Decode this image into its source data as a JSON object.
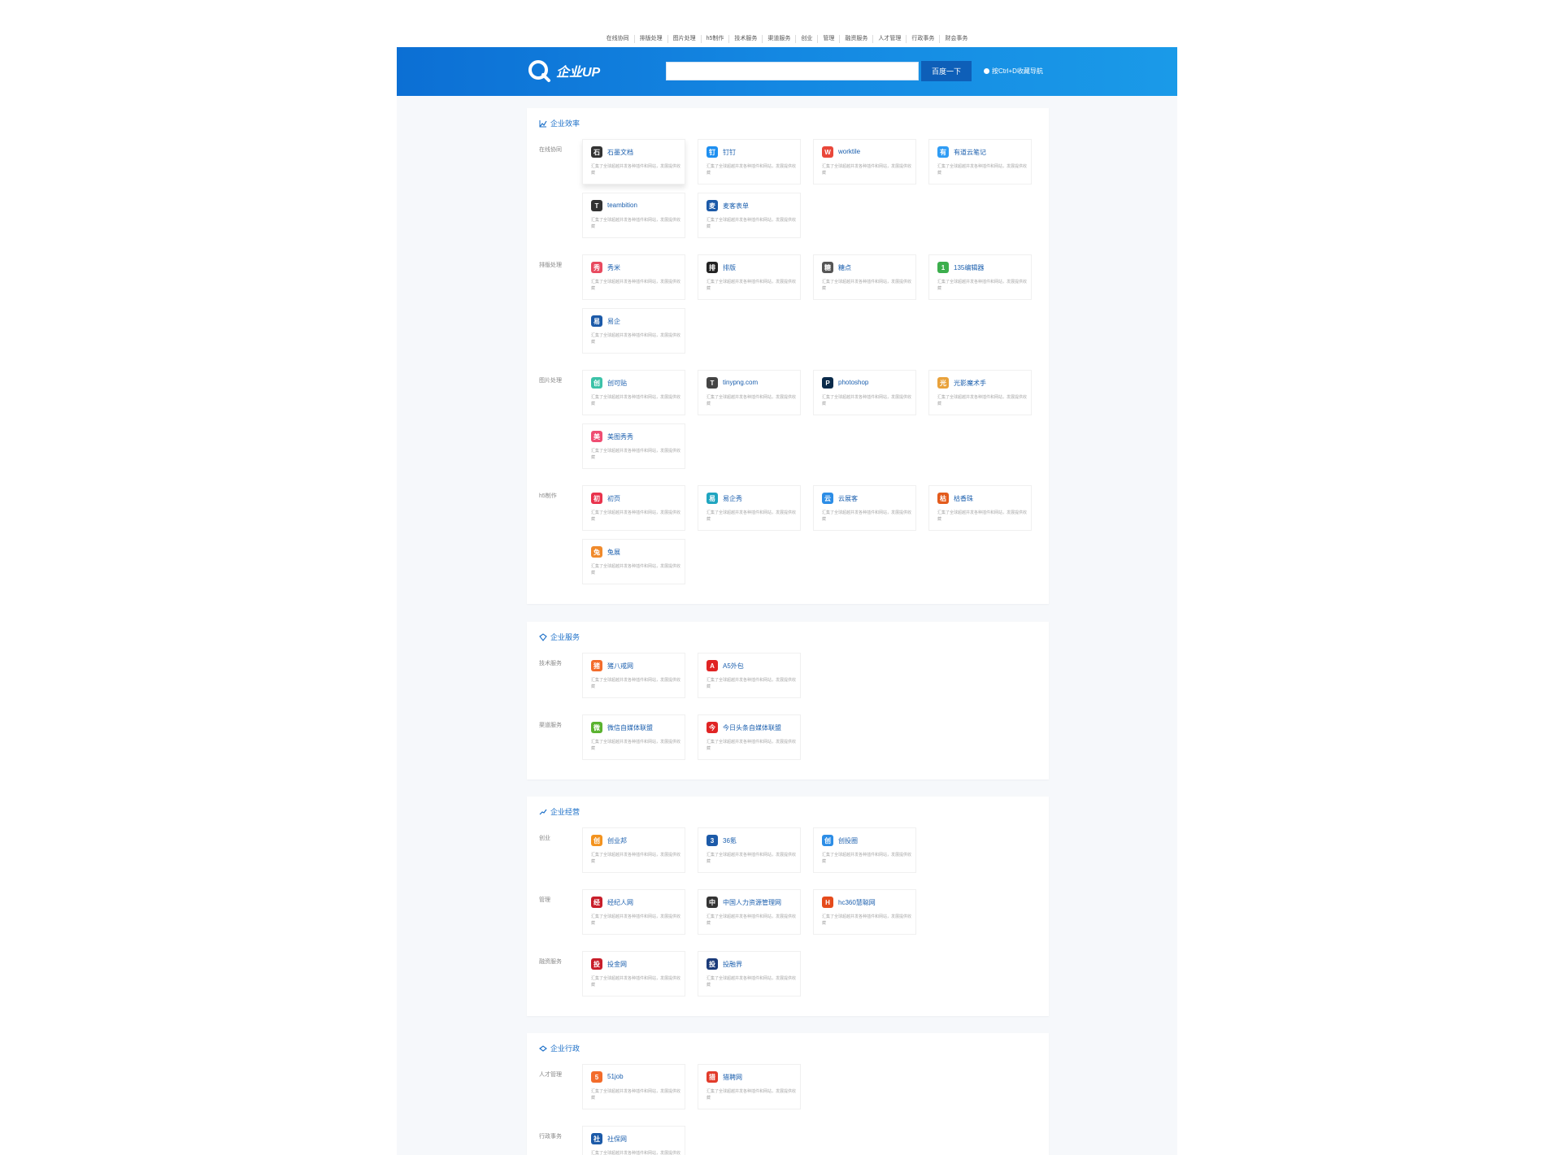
{
  "topnav": [
    "在线协同",
    "排版处理",
    "图片处理",
    "h5制作",
    "技术服务",
    "渠道服务",
    "创业",
    "管理",
    "融资服务",
    "人才管理",
    "行政事务",
    "财会事务"
  ],
  "header": {
    "logo_text": "企业UP",
    "search_placeholder": "",
    "search_button": "百度一下",
    "favorite_hint": "按Ctrl+D收藏导航"
  },
  "card_desc": "汇集了全球超越并发各种插件和网站，发展提供收藏",
  "sections": [
    {
      "title": "企业效率",
      "groups": [
        {
          "label": "在线协同",
          "items": [
            {
              "name": "石墨文档",
              "icon": "shimo-icon",
              "color": "#333333"
            },
            {
              "name": "钉钉",
              "icon": "dingtalk-icon",
              "color": "#1e8ff0"
            },
            {
              "name": "worktile",
              "icon": "worktile-icon",
              "color": "#e9473a"
            },
            {
              "name": "有道云笔记",
              "icon": "youdao-note-icon",
              "color": "#2f9cf4"
            },
            {
              "name": "teambition",
              "icon": "teambition-icon",
              "color": "#333333"
            },
            {
              "name": "麦客表单",
              "icon": "mikecrm-icon",
              "color": "#1c5aa8"
            }
          ]
        },
        {
          "label": "排版处理",
          "items": [
            {
              "name": "秀米",
              "icon": "xiumi-icon",
              "color": "#e84a5f"
            },
            {
              "name": "排版",
              "icon": "paiban-icon",
              "color": "#222222"
            },
            {
              "name": "糖点",
              "icon": "tangdian-icon",
              "color": "#555555"
            },
            {
              "name": "135编辑器",
              "icon": "135-editor-icon",
              "color": "#3cae4d"
            },
            {
              "name": "易企",
              "icon": "yiqi-icon",
              "color": "#1c5aa8"
            }
          ]
        },
        {
          "label": "图片处理",
          "items": [
            {
              "name": "创可贴",
              "icon": "chuangkit-icon",
              "color": "#3cc2a8"
            },
            {
              "name": "tinypng.com",
              "icon": "tinypng-icon",
              "color": "#444444"
            },
            {
              "name": "photoshop",
              "icon": "photoshop-icon",
              "color": "#0a2a4a"
            },
            {
              "name": "光影魔术手",
              "icon": "neoimaging-icon",
              "color": "#e9a23b"
            },
            {
              "name": "美图秀秀",
              "icon": "meitu-icon",
              "color": "#ef4d72"
            }
          ]
        },
        {
          "label": "h5制作",
          "items": [
            {
              "name": "初页",
              "icon": "chuye-icon",
              "color": "#e9334d"
            },
            {
              "name": "易企秀",
              "icon": "eqxiu-icon",
              "color": "#1fa5c0"
            },
            {
              "name": "云展客",
              "icon": "yunzhanke-icon",
              "color": "#2c8de6"
            },
            {
              "name": "枯香珠",
              "icon": "kuxiang-icon",
              "color": "#e35b1c"
            },
            {
              "name": "兔展",
              "icon": "rabbitpre-icon",
              "color": "#f08a2c"
            }
          ]
        }
      ]
    },
    {
      "title": "企业服务",
      "groups": [
        {
          "label": "技术服务",
          "items": [
            {
              "name": "猪八戒网",
              "icon": "zbj-icon",
              "color": "#f36c2b"
            },
            {
              "name": "A5外包",
              "icon": "a5-icon",
              "color": "#e02424"
            }
          ]
        },
        {
          "label": "渠道服务",
          "items": [
            {
              "name": "微信自媒体联盟",
              "icon": "wechat-icon",
              "color": "#5ab22f"
            },
            {
              "name": "今日头条自媒体联盟",
              "icon": "toutiao-icon",
              "color": "#e02424"
            }
          ]
        }
      ]
    },
    {
      "title": "企业经营",
      "groups": [
        {
          "label": "创业",
          "items": [
            {
              "name": "创业邦",
              "icon": "cyzone-icon",
              "color": "#f3931f"
            },
            {
              "name": "36氪",
              "icon": "36kr-icon",
              "color": "#1c5aa8"
            },
            {
              "name": "创投圈",
              "icon": "vc-icon",
              "color": "#2c8de6"
            }
          ]
        },
        {
          "label": "管理",
          "items": [
            {
              "name": "经纪人网",
              "icon": "jingjiren-icon",
              "color": "#c81e2a"
            },
            {
              "name": "中国人力资源管理网",
              "icon": "hrm-icon",
              "color": "#333333"
            },
            {
              "name": "hc360慧聪网",
              "icon": "hc360-icon",
              "color": "#e54b1c"
            }
          ]
        },
        {
          "label": "融资服务",
          "items": [
            {
              "name": "投金网",
              "icon": "touzi-icon",
              "color": "#c81e2a"
            },
            {
              "name": "投融界",
              "icon": "trjcn-icon",
              "color": "#1b3b7a"
            }
          ]
        }
      ]
    },
    {
      "title": "企业行政",
      "groups": [
        {
          "label": "人才管理",
          "items": [
            {
              "name": "51job",
              "icon": "51job-icon",
              "color": "#f36c2b"
            },
            {
              "name": "猎聘网",
              "icon": "liepin-icon",
              "color": "#e23b2a"
            }
          ]
        },
        {
          "label": "行政事务",
          "items": [
            {
              "name": "社保网",
              "icon": "shebao-icon",
              "color": "#1c5aa8"
            }
          ]
        }
      ]
    }
  ]
}
